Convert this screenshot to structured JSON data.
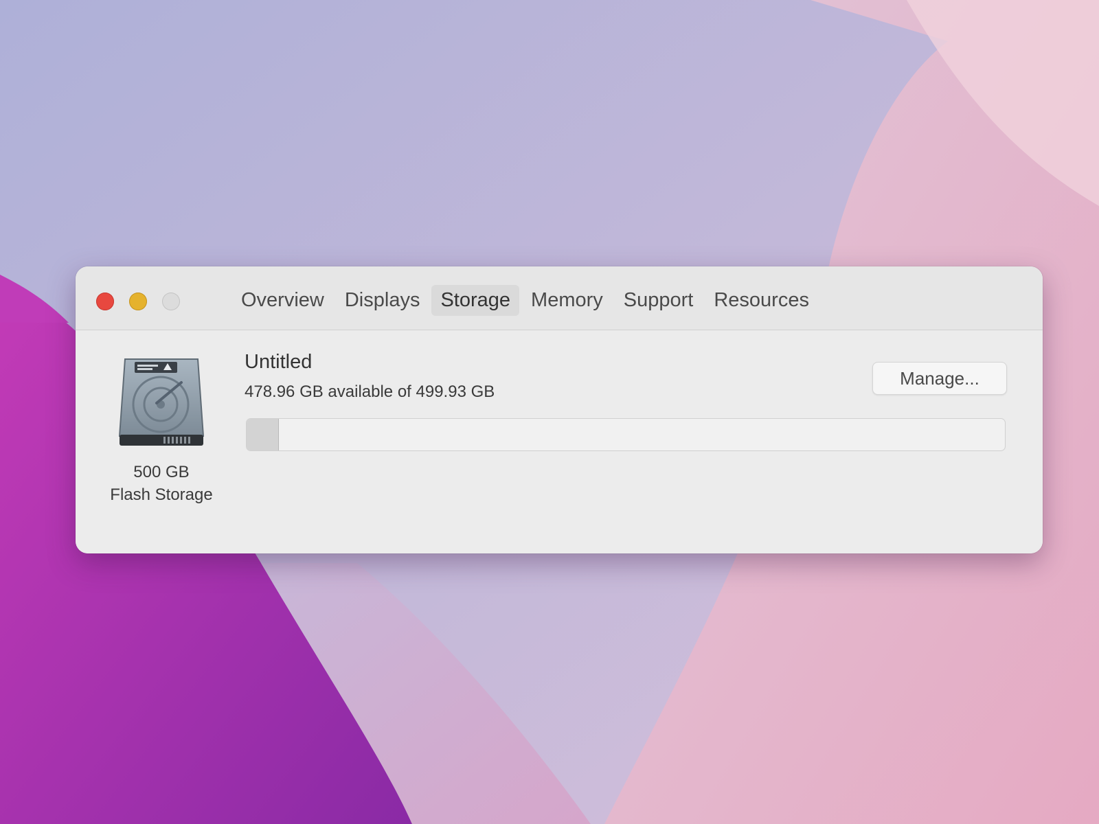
{
  "window": {
    "tabs": [
      {
        "label": "Overview"
      },
      {
        "label": "Displays"
      },
      {
        "label": "Storage",
        "active": true
      },
      {
        "label": "Memory"
      },
      {
        "label": "Support"
      },
      {
        "label": "Resources"
      }
    ]
  },
  "storage": {
    "disk_icon": "hard-drive-icon",
    "disk_size": "500 GB",
    "disk_type": "Flash Storage",
    "volume_name": "Untitled",
    "capacity_text": "478.96 GB available of 499.93 GB",
    "available_gb": 478.96,
    "total_gb": 499.93,
    "manage_label": "Manage..."
  },
  "colors": {
    "close": "#e8483f",
    "minimize": "#e5b22d",
    "zoom_inactive": "#dcdcdc",
    "wallpaper_magenta": "#a42bb4",
    "wallpaper_pink": "#e3a9c4",
    "wallpaper_lavender": "#bdb6dc"
  }
}
